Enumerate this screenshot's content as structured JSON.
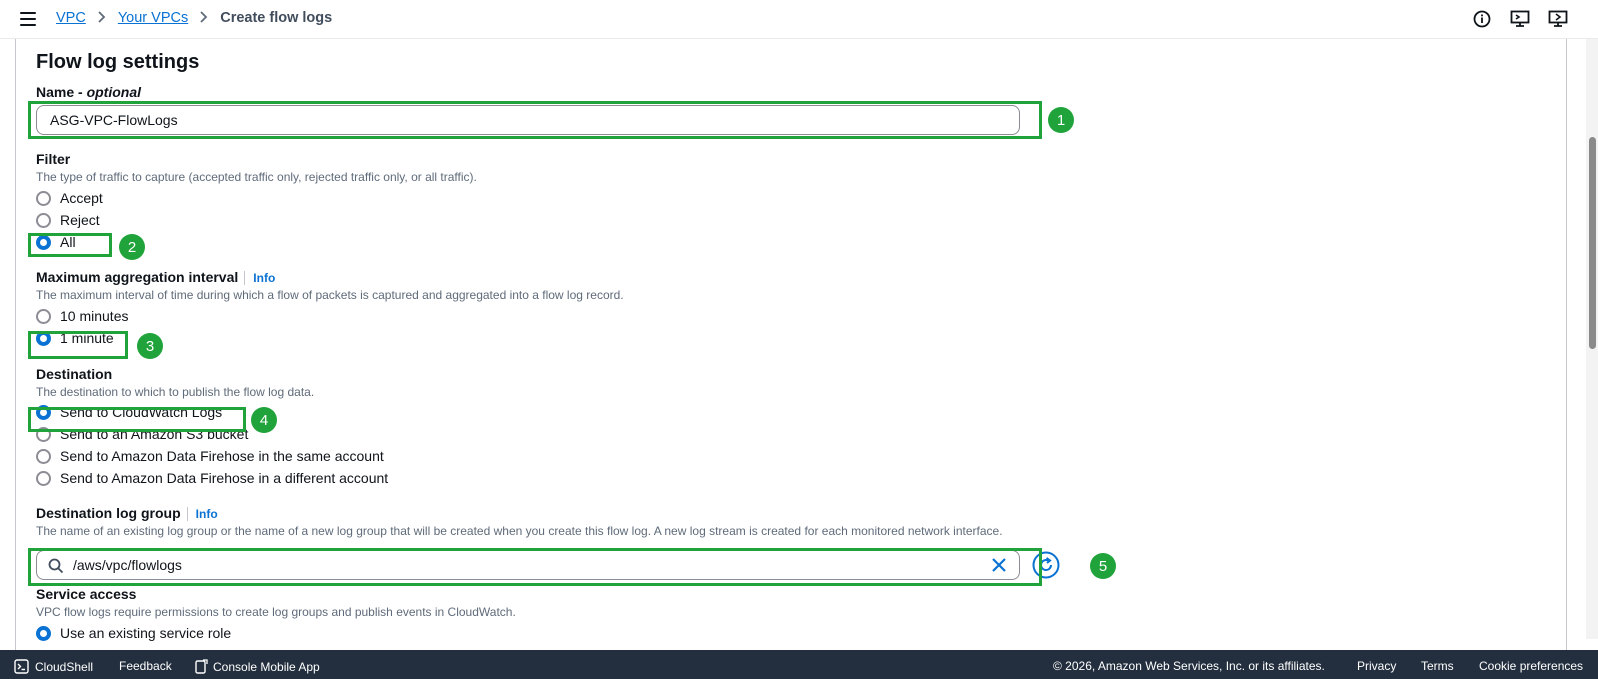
{
  "header": {
    "breadcrumb": [
      "VPC",
      "Your VPCs",
      "Create flow logs"
    ],
    "icons": [
      "info-icon",
      "support-icon",
      "feedback-icon"
    ]
  },
  "section": {
    "title": "Flow log settings"
  },
  "name": {
    "label": "Name - ",
    "label_suffix": "optional",
    "value": "ASG-VPC-FlowLogs"
  },
  "filter": {
    "label": "Filter",
    "description": "The type of traffic to capture (accepted traffic only, rejected traffic only, or all traffic).",
    "options": [
      "Accept",
      "Reject",
      "All"
    ],
    "selected": "All"
  },
  "interval": {
    "label": "Maximum aggregation interval",
    "info": "Info",
    "description": "The maximum interval of time during which a flow of packets is captured and aggregated into a flow log record.",
    "options": [
      "10 minutes",
      "1 minute"
    ],
    "selected": "1 minute"
  },
  "destination": {
    "label": "Destination",
    "description": "The destination to which to publish the flow log data.",
    "options": [
      "Send to CloudWatch Logs",
      "Send to an Amazon S3 bucket",
      "Send to Amazon Data Firehose in the same account",
      "Send to Amazon Data Firehose in a different account"
    ],
    "selected": "Send to CloudWatch Logs"
  },
  "log_group": {
    "label": "Destination log group",
    "info": "Info",
    "description": "The name of an existing log group or the name of a new log group that will be created when you create this flow log. A new log stream is created for each monitored network interface.",
    "value": "/aws/vpc/flowlogs"
  },
  "service_access": {
    "label": "Service access",
    "description": "VPC flow logs require permissions to create log groups and publish events in CloudWatch.",
    "option": "Use an existing service role"
  },
  "annotations": [
    "1",
    "2",
    "3",
    "4",
    "5"
  ],
  "footer": {
    "cloudshell": "CloudShell",
    "feedback": "Feedback",
    "mobile_app": "Console Mobile App",
    "copyright": "© 2026, Amazon Web Services, Inc. or its affiliates.",
    "privacy": "Privacy",
    "terms": "Terms",
    "cookie": "Cookie preferences"
  },
  "colors": {
    "accent": "#0972d3",
    "annotation": "#1fa33a",
    "footer_bg": "#232f3e"
  }
}
